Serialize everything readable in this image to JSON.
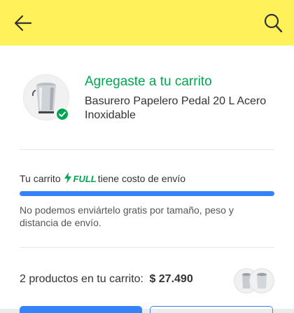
{
  "header": {
    "back_icon": "arrow-left-icon",
    "search_icon": "search-icon",
    "background": "#fff159"
  },
  "cart_added": {
    "title": "Agregaste a tu carrito",
    "product_name": "Basurero Papelero Pedal 20 L Acero Inoxidable",
    "check_icon": "check-circle-icon",
    "accent": "#00a650"
  },
  "shipping": {
    "prefix": "Tu carrito",
    "badge": "FULL",
    "suffix": "tiene costo de envío",
    "progress": 1.0,
    "message": "No podemos enviártelo gratis por tamaño, peso y distancia de envío.",
    "bar_color": "#3483fa"
  },
  "summary": {
    "label": "2 productos en tu carrito:",
    "total": "$ 27.490"
  }
}
